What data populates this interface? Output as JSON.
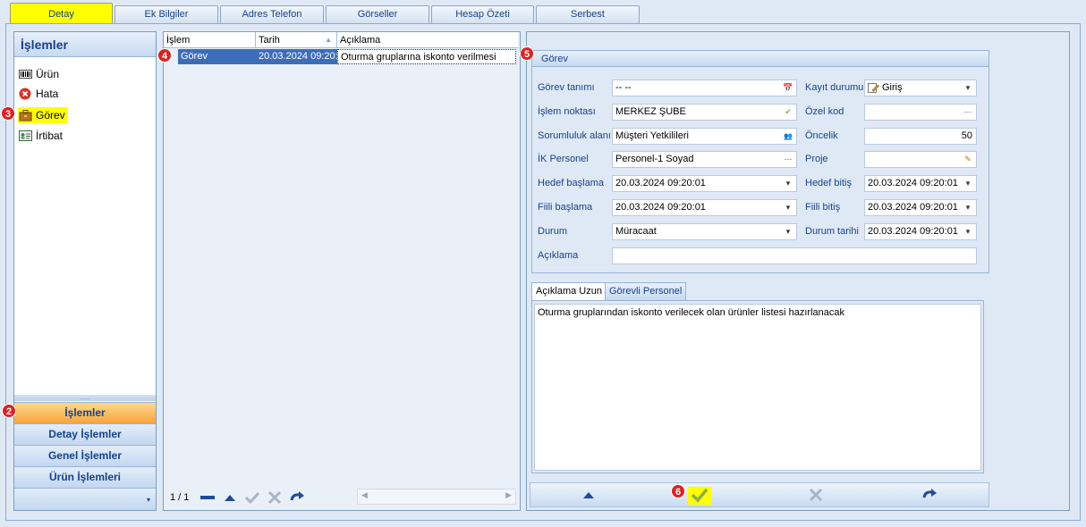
{
  "top_tabs": [
    {
      "label": "Detay",
      "active": true
    },
    {
      "label": "Ek Bilgiler"
    },
    {
      "label": "Adres Telefon"
    },
    {
      "label": "Görseller"
    },
    {
      "label": "Hesap Özeti"
    },
    {
      "label": "Serbest"
    }
  ],
  "left_nav": {
    "title": "İşlemler",
    "items": [
      {
        "label": "Ürün",
        "icon": "barcode-icon"
      },
      {
        "label": "Hata",
        "icon": "error-icon"
      },
      {
        "label": "Görev",
        "icon": "briefcase-icon",
        "selected": true
      },
      {
        "label": "İrtibat",
        "icon": "contact-card-icon"
      }
    ],
    "groups": [
      "İşlemler",
      "Detay İşlemler",
      "Genel İşlemler",
      "Ürün İşlemleri"
    ],
    "splitter_grip": ".....",
    "footer_chevron": "▾"
  },
  "grid": {
    "columns": [
      "İşlem",
      "Tarih",
      "Açıklama"
    ],
    "sort_indicator": "▲",
    "rows": [
      {
        "islem": "Görev",
        "tarih": "20.03.2024 09:20:",
        "aciklama": "Oturma gruplarına iskonto verilmesi"
      }
    ],
    "page_info": "1 / 1",
    "toolbar_icons": [
      "minus-icon",
      "up-arrow-icon",
      "check-icon",
      "cross-icon",
      "refresh-icon"
    ],
    "scroll_left": "◀",
    "scroll_right": "▶"
  },
  "form": {
    "group_title": "Görev",
    "fields": {
      "gorev_tanimi": {
        "label": "Görev tanımı",
        "value": "-- --",
        "btn": "📅"
      },
      "islem_noktasi": {
        "label": "İşlem noktası",
        "value": "MERKEZ ŞUBE",
        "btn": "✔"
      },
      "sorumluluk_alani": {
        "label": "Sorumluluk alanı",
        "value": "Müşteri Yetkilileri",
        "btn": "👥"
      },
      "ik_personel": {
        "label": "İK Personel",
        "value": "Personel-1 Soyad",
        "btn": "···"
      },
      "hedef_baslama": {
        "label": "Hedef başlama",
        "value": "20.03.2024 09:20:01",
        "btn": "▾"
      },
      "fiili_baslama": {
        "label": "Fiili başlama",
        "value": "20.03.2024 09:20:01",
        "btn": "▾"
      },
      "durum": {
        "label": "Durum",
        "value": "Müracaat",
        "btn": "▾"
      },
      "aciklama": {
        "label": "Açıklama",
        "value": ""
      },
      "kayit_durumu": {
        "label": "Kayıt durumu",
        "value": "Giriş",
        "btn": "▾"
      },
      "ozel_kod": {
        "label": "Özel kod",
        "value": "",
        "btn": "···"
      },
      "oncelik": {
        "label": "Öncelik",
        "value": "50"
      },
      "proje": {
        "label": "Proje",
        "value": "",
        "btn": "✎"
      },
      "hedef_bitis": {
        "label": "Hedef bitiş",
        "value": "20.03.2024 09:20:01",
        "btn": "▾"
      },
      "fiili_bitis": {
        "label": "Fiili bitiş",
        "value": "20.03.2024 09:20:01",
        "btn": "▾"
      },
      "durum_tarihi": {
        "label": "Durum tarihi",
        "value": "20.03.2024 09:20:01",
        "btn": "▾"
      }
    },
    "sub_tabs": [
      "Açıklama Uzun",
      "Görevli Personel"
    ],
    "memo_text": "Oturma gruplarından iskonto verilecek olan ürünler listesi hazırlanacak",
    "toolbar_icons": [
      "up-arrow-icon",
      "check-icon",
      "cross-icon",
      "refresh-icon"
    ]
  },
  "markers": [
    "2",
    "3",
    "4",
    "5",
    "6"
  ],
  "colors": {
    "highlight": "#ffff00",
    "accent": "#15428b",
    "marker": "#e02020",
    "nav_active": "#f7a53c",
    "grid_selection": "#3d6db8"
  }
}
